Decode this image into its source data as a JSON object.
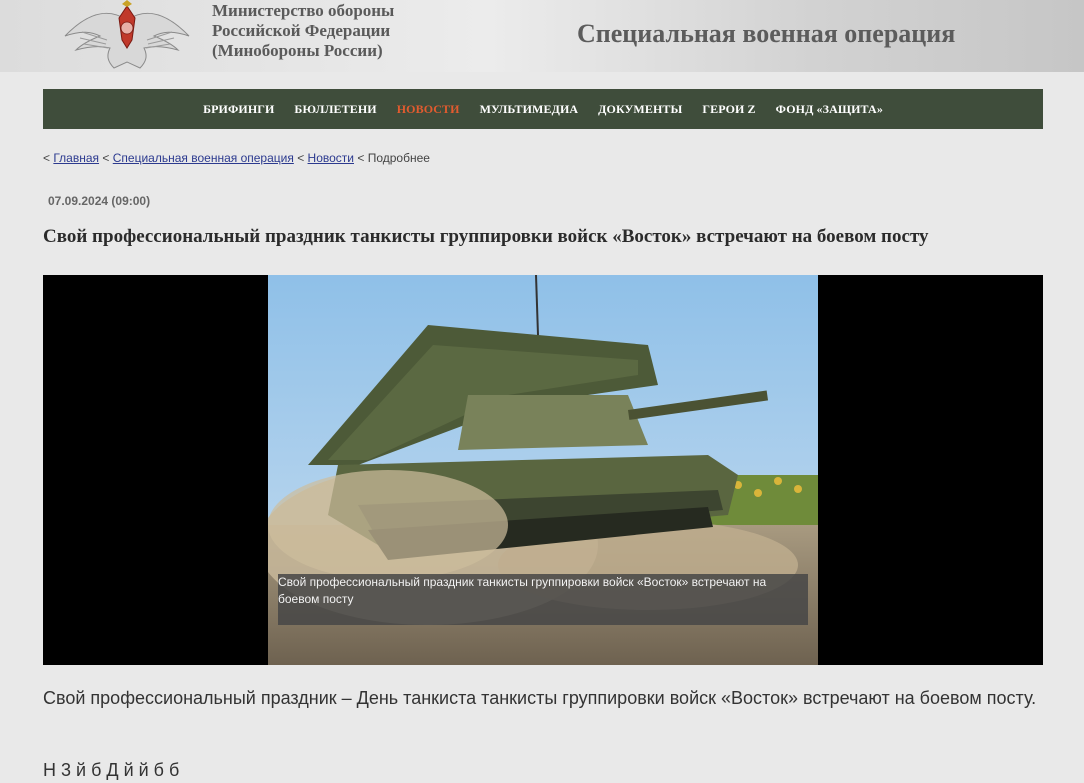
{
  "header": {
    "ministry_line1": "Министерство обороны",
    "ministry_line2": "Российской Федерации",
    "ministry_line3": "(Минобороны России)",
    "section_title": "Специальная военная операция",
    "emblem_icon": "double-headed-eagle-emblem-icon"
  },
  "nav": {
    "items": [
      {
        "label": "БРИФИНГИ"
      },
      {
        "label": "БЮЛЛЕТЕНИ"
      },
      {
        "label": "НОВОСТИ",
        "active": true
      },
      {
        "label": "МУЛЬТИМЕДИА"
      },
      {
        "label": "ДОКУМЕНТЫ"
      },
      {
        "label": "ГЕРОИ Z"
      },
      {
        "label": "ФОНД «ЗАЩИТА»"
      }
    ],
    "active_color": "#e25b2f",
    "bg_color": "#3f4d3b"
  },
  "breadcrumb": {
    "sep": "<",
    "home": "Главная",
    "section": "Специальная военная операция",
    "news": "Новости",
    "current": "Подробнее"
  },
  "article": {
    "date": "07.09.2024 (09:00)",
    "title": "Свой профессиональный праздник танкисты группировки войск «Восток» встречают на боевом посту",
    "image_caption": "Свой профессиональный праздник танкисты группировки войск «Восток» встречают на боевом посту",
    "paragraph1": "Свой профессиональный праздник – День танкиста танкисты группировки войск «Восток» встречают на боевом посту.",
    "paragraph2_partial": "Н                        3                  й    б          Д                й                  й         б                       б"
  }
}
